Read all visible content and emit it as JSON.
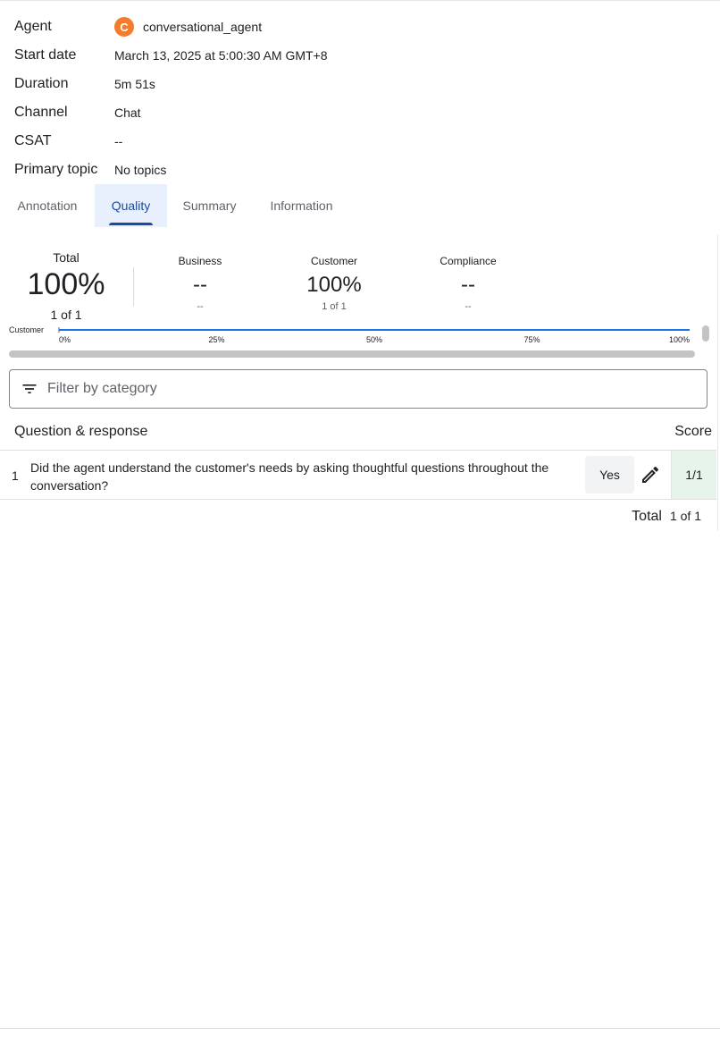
{
  "meta": {
    "agent_label": "Agent",
    "agent_avatar": "C",
    "agent_value": "conversational_agent",
    "start_label": "Start date",
    "start_value": "March 13, 2025 at 5:00:30 AM GMT+8",
    "duration_label": "Duration",
    "duration_value": "5m 51s",
    "channel_label": "Channel",
    "channel_value": "Chat",
    "csat_label": "CSAT",
    "csat_value": "--",
    "topic_label": "Primary topic",
    "topic_value": "No topics"
  },
  "tabs": [
    {
      "label": "Annotation",
      "active": false
    },
    {
      "label": "Quality",
      "active": true
    },
    {
      "label": "Summary",
      "active": false
    },
    {
      "label": "Information",
      "active": false
    }
  ],
  "quality": {
    "total": {
      "label": "Total",
      "value": "100%",
      "sub": "1 of 1"
    },
    "categories": [
      {
        "label": "Business",
        "value": "--",
        "sub": "--"
      },
      {
        "label": "Customer",
        "value": "100%",
        "sub": "1 of 1"
      },
      {
        "label": "Compliance",
        "value": "--",
        "sub": "--"
      }
    ],
    "chart": {
      "series_label": "Customer",
      "ticks": [
        "0%",
        "25%",
        "50%",
        "75%",
        "100%"
      ],
      "value_percent": 100,
      "color": "#1a73e8"
    },
    "filter_placeholder": "Filter by category",
    "table": {
      "question_header": "Question & response",
      "score_header": "Score",
      "rows": [
        {
          "number": "1",
          "question": "Did the agent understand the customer's needs by asking thoughtful questions throughout the conversation?",
          "answer": "Yes",
          "score": "1/1"
        }
      ]
    },
    "footer": {
      "label": "Total",
      "value": "1 of 1"
    }
  },
  "colors": {
    "accent": "#1a4a9c",
    "avatar": "#f57c2a",
    "score_bg": "#e6f4ea"
  },
  "icons": {
    "filter": "filter-list-icon",
    "edit": "pencil-icon"
  }
}
